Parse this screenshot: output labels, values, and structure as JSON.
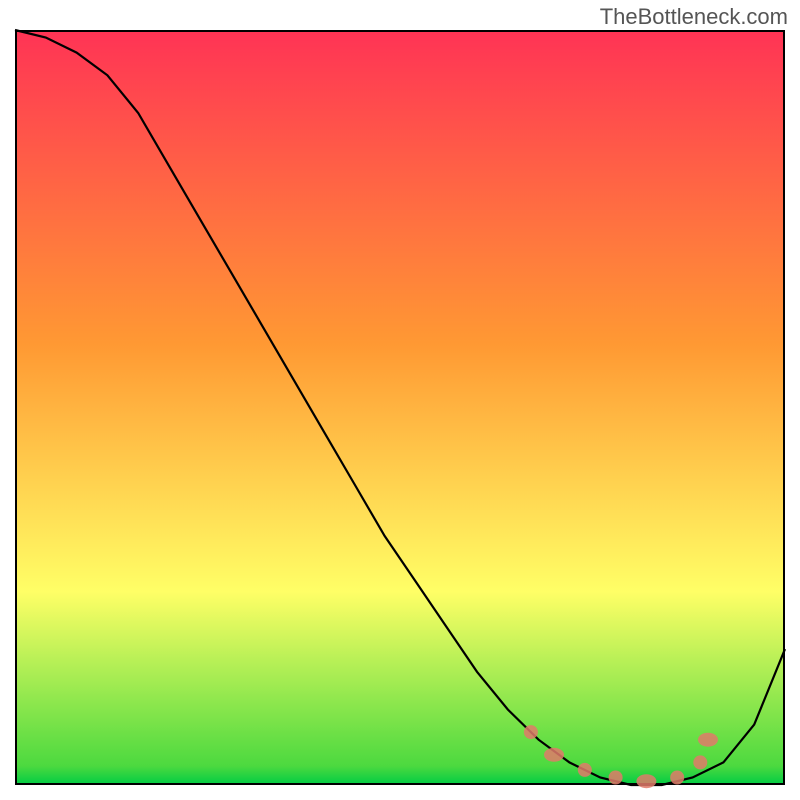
{
  "watermark": "TheBottleneck.com",
  "chart_data": {
    "type": "line",
    "title": "",
    "xlabel": "",
    "ylabel": "",
    "xlim": [
      0,
      100
    ],
    "ylim": [
      0,
      100
    ],
    "grid": false,
    "series": [
      {
        "name": "curve",
        "color": "#000000",
        "x": [
          0,
          4,
          8,
          12,
          16,
          20,
          24,
          28,
          32,
          36,
          40,
          44,
          48,
          52,
          56,
          60,
          64,
          68,
          72,
          76,
          80,
          84,
          88,
          92,
          96,
          100
        ],
        "y": [
          100,
          99,
          97,
          94,
          89,
          82,
          75,
          68,
          61,
          54,
          47,
          40,
          33,
          27,
          21,
          15,
          10,
          6,
          3,
          1,
          0,
          0,
          1,
          3,
          8,
          18
        ]
      }
    ],
    "markers": {
      "comment": "highlighted points near the minimum (salmon markers)",
      "color": "#e07a6a",
      "points_x": [
        67,
        70,
        74,
        78,
        82,
        86,
        89,
        90
      ],
      "points_y": [
        7,
        4,
        2,
        1,
        0.5,
        1,
        3,
        6
      ]
    },
    "background_gradient_stops": [
      {
        "pos": 0.0,
        "color": "#00cc44"
      },
      {
        "pos": 0.025,
        "color": "#4cd93f"
      },
      {
        "pos": 0.256,
        "color": "#ffff66"
      },
      {
        "pos": 0.583,
        "color": "#ff9933"
      },
      {
        "pos": 1.0,
        "color": "#ff3355"
      }
    ]
  }
}
